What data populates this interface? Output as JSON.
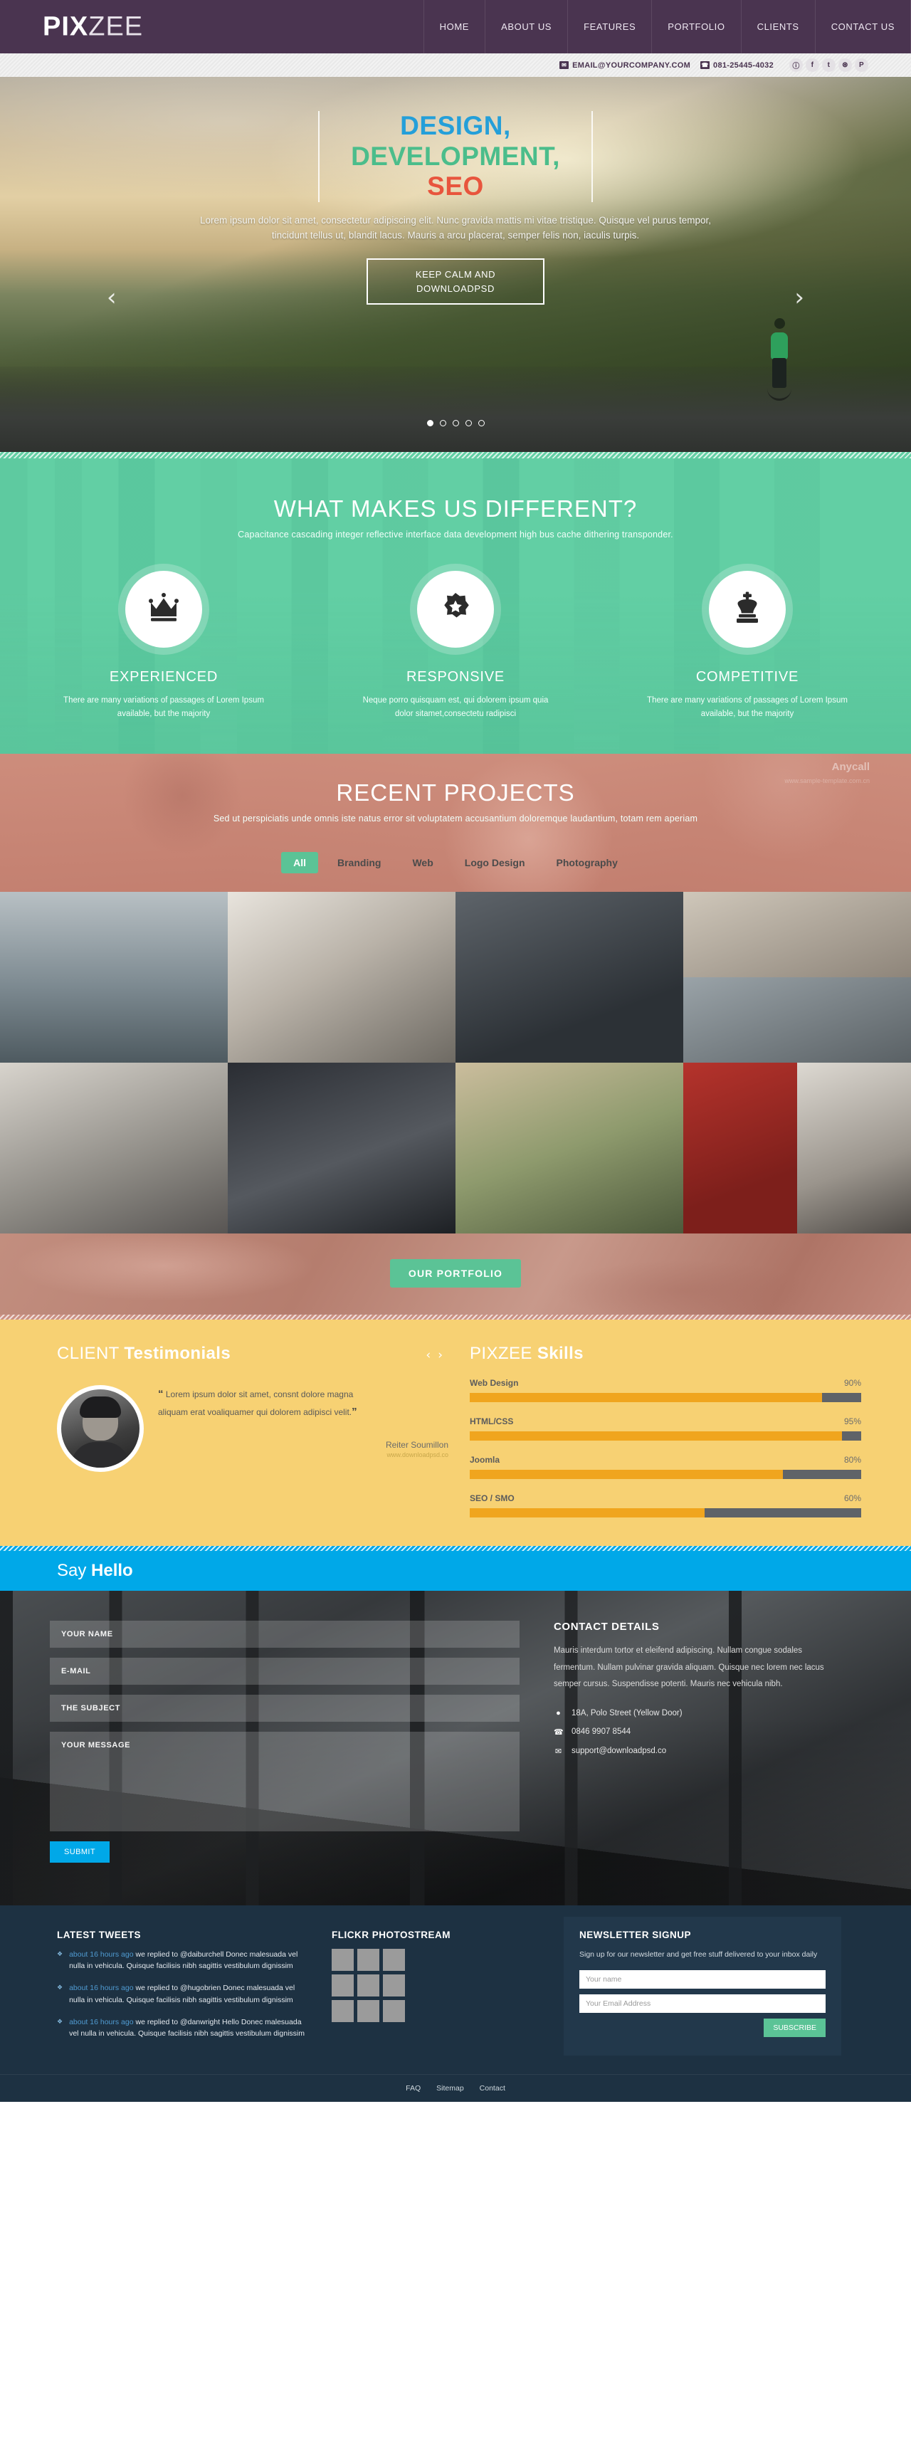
{
  "brand": {
    "bold": "PIX",
    "light": "ZEE"
  },
  "nav": {
    "items": [
      "HOME",
      "ABOUT US",
      "FEATURES",
      "PORTFOLIO",
      "CLIENTS",
      "CONTACT US"
    ]
  },
  "contactbar": {
    "email": "EMAIL@YOURCOMPANY.COM",
    "phone": "081-25445-4032",
    "socials": [
      "rss-icon",
      "facebook-icon",
      "twitter-icon",
      "dribbble-icon",
      "pinterest-icon"
    ],
    "social_glyphs": [
      "ⓘ",
      "f",
      "t",
      "⊛",
      "P"
    ]
  },
  "hero": {
    "line1": "DESIGN,",
    "line2": "DEVELOPMENT,",
    "line3": "SEO",
    "colors": {
      "line1": "#249fd9",
      "line2": "#4bbd8b",
      "line3": "#e8553d"
    },
    "paragraph": "Lorem ipsum dolor sit amet, consectetur adipiscing elit. Nunc gravida mattis mi vitae tristique. Quisque vel purus tempor, tincidunt tellus ut, blandit lacus. Mauris a arcu placerat, semper felis non, iaculis turpis.",
    "button_line1": "KEEP CALM AND",
    "button_line2": "DOWNLOADPSD",
    "prev": "‹",
    "next": "›",
    "dots": 5,
    "active_dot": 0
  },
  "different": {
    "title": "WHAT MAKES US DIFFERENT?",
    "subtitle": "Capacitance cascading integer reflective interface data development high bus cache dithering transponder.",
    "accent": "#62cfa4",
    "columns": [
      {
        "icon": "crown-icon",
        "title": "EXPERIENCED",
        "text": "There are many variations of passages of Lorem Ipsum available, but the majority"
      },
      {
        "icon": "star-badge-icon",
        "title": "RESPONSIVE",
        "text": "Neque porro quisquam est, qui dolorem ipsum quia dolor sitamet,consectetu radipisci"
      },
      {
        "icon": "chess-king-icon",
        "title": "COMPETITIVE",
        "text": "There are many variations of passages of Lorem Ipsum available, but the majority"
      }
    ]
  },
  "projects": {
    "title": "RECENT PROJECTS",
    "subtitle": "Sed ut perspiciatis unde omnis iste natus error sit voluptatem accusantium doloremque laudantium, totam rem aperiam",
    "watermark": "Anycall",
    "watermark_url": "www.sample-template.com.cn",
    "filters": [
      "All",
      "Branding",
      "Web",
      "Logo Design",
      "Photography"
    ],
    "active_filter": "All",
    "cta_label": "OUR PORTFOLIO",
    "thumbnails": [
      "person-in-mist",
      "desk-with-laptop",
      "flatlay-gadgets",
      "framed-picture",
      "wooden-bench",
      "office-workstation",
      "car-interior-phone",
      "girl-on-road",
      "red-backpack",
      "vintage-camera"
    ]
  },
  "testimonials": {
    "title_light": "CLIENT ",
    "title_bold": "Testimonials",
    "prev": "‹",
    "next": "›",
    "quote": "Lorem ipsum dolor sit amet, consnt dolore magna aliquam erat voaliquamer qui dolorem adipisci velit.",
    "quote_open": "“",
    "quote_close": "”",
    "author": "Reiter Soumillon",
    "author_site": "www.downloadpsd.co",
    "avatar": "client-portrait"
  },
  "skills": {
    "title_light": "PIXZEE ",
    "title_bold": "Skills",
    "bar_fill_color": "#f0a51e",
    "bar_track_color": "#5f6368",
    "items": [
      {
        "label": "Web Design",
        "value": 90,
        "display": "90%"
      },
      {
        "label": "HTML/CSS",
        "value": 95,
        "display": "95%"
      },
      {
        "label": "Joomla",
        "value": 80,
        "display": "80%"
      },
      {
        "label": "SEO / SMO",
        "value": 60,
        "display": "60%"
      }
    ]
  },
  "hello": {
    "title_light": "Say ",
    "title_bold": "Hello",
    "color": "#00a8e8"
  },
  "contact": {
    "fields": {
      "name": "YOUR NAME",
      "email": "E-MAIL",
      "subject": "THE SUBJECT",
      "message": "YOUR MESSAGE"
    },
    "submit_label": "SUBMIT",
    "details_title": "CONTACT DETAILS",
    "details_text": "Mauris interdum tortor et eleifend adipiscing. Nullam congue sodales fermentum. Nullam pulvinar gravida aliquam. Quisque nec lorem nec lacus semper cursus. Suspendisse potenti. Mauris nec vehicula nibh.",
    "address": "18A, Polo Street (Yellow Door)",
    "phone": "0846 9907 8544",
    "email": "support@downloadpsd.co",
    "address_icon": "map-pin-icon",
    "phone_icon": "phone-icon",
    "email_icon": "envelope-icon"
  },
  "footer": {
    "tweets_title": "LATEST TWEETS",
    "tweets": [
      {
        "time": "about 16 hours ago",
        "text": " we replied to @daiburchell Donec malesuada vel nulla in vehicula. Quisque facilisis nibh sagittis vestibulum dignissim"
      },
      {
        "time": "about 16 hours ago",
        "text": " we replied to @hugobrien Donec malesuada vel nulla in vehicula. Quisque facilisis nibh sagittis vestibulum dignissim"
      },
      {
        "time": "about 16 hours ago",
        "text": " we replied to @danwright Hello Donec malesuada vel nulla in vehicula. Quisque facilisis nibh sagittis vestibulum dignissim"
      }
    ],
    "flickr_title": "FLICKR PHOTOSTREAM",
    "flickr_count": 9,
    "newsletter_title": "NEWSLETTER SIGNUP",
    "newsletter_text": "Sign up for our newsletter and get free stuff delivered to your inbox daily",
    "newsletter_name_placeholder": "Your name",
    "newsletter_email_placeholder": "Your Email Address",
    "newsletter_button": "SUBSCRIBE",
    "bottom_links": [
      "FAQ",
      "Sitemap",
      "Contact"
    ]
  }
}
